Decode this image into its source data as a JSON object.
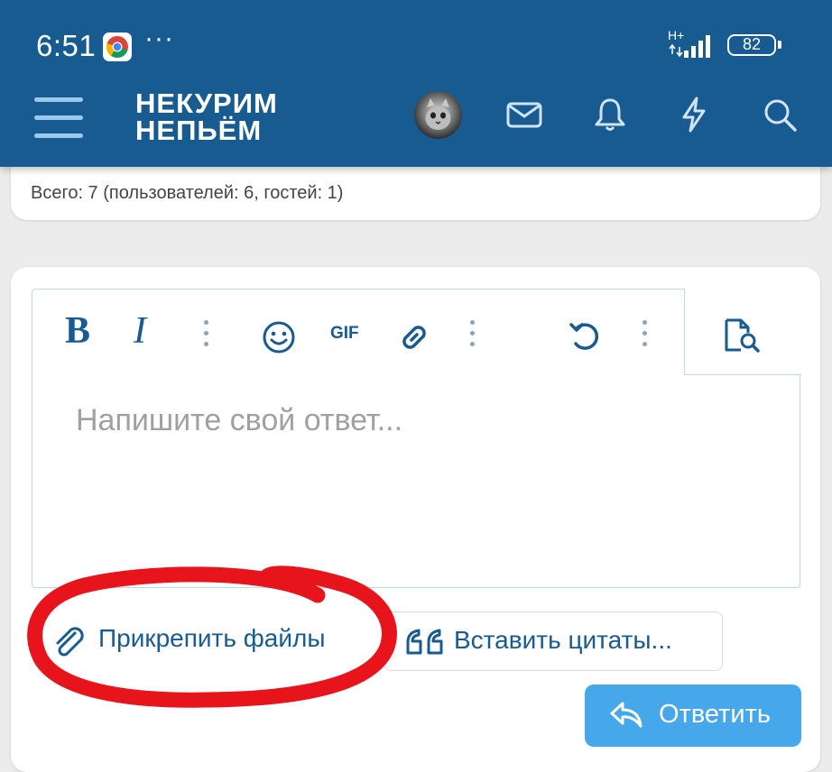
{
  "status_bar": {
    "time": "6:51",
    "dots": "···",
    "network": "H+",
    "battery": "82"
  },
  "header": {
    "logo_line1": "НЕКУРИМ",
    "logo_line2": "НЕПЬЁМ",
    "icons": [
      "menu-icon",
      "avatar",
      "mail-icon",
      "bell-icon",
      "lightning-icon",
      "search-icon"
    ]
  },
  "online": {
    "text": "Всего: 7 (пользователей: 6, гостей: 1)"
  },
  "editor": {
    "toolbar": {
      "bold": "B",
      "italic": "I",
      "gif": "GIF",
      "icons": [
        "bold-icon",
        "italic-icon",
        "more-icon",
        "smiley-icon",
        "gif-icon",
        "link-icon",
        "more-icon",
        "undo-icon",
        "more-icon",
        "preview-icon"
      ]
    },
    "placeholder": "Напишите свой ответ..."
  },
  "actions": {
    "attach_label": "Прикрепить файлы",
    "quotes_label": "Вставить цитаты...",
    "reply_label": "Ответить"
  },
  "colors": {
    "header_bg": "#185b91",
    "accent": "#185b91",
    "button_bg": "#47a7eb",
    "annotation": "#e8141c"
  }
}
